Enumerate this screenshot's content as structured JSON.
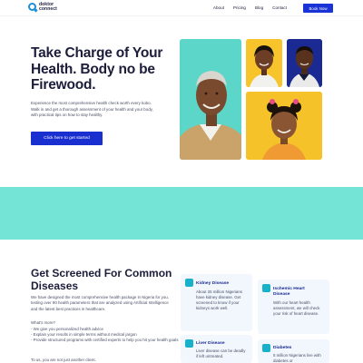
{
  "header": {
    "logo_line1": "doktor",
    "logo_line2": "connect",
    "nav": [
      "About",
      "Pricing",
      "Blog",
      "Contact"
    ],
    "book_label": "Book Now"
  },
  "hero": {
    "title": "Take Charge of Your Health. Body no be Firewood.",
    "description": "Experience the most comprehensive health check worth every kobo. Walk in and get a thorough assessment of your health and your body, with practical tips on how to stay healthy.",
    "cta_label": "Click here to get started"
  },
  "screening": {
    "title": "Get Screened For Common Diseases",
    "paragraph": "We have designed the most comprehensive health package in Nigeria for you, testing over 90 health parameters that are analyzed using Artificial Intelligence and the latest best practices in healthcare.",
    "whats_more": "What's more?",
    "list": [
      "- We give you personalized health advice",
      "- Explain your results in simple terms without medical jargon",
      "- Provide structured programs with certified experts to help you hit your health goals"
    ],
    "closing": "To us, you are not just another client."
  },
  "cards": [
    {
      "title": "Kidney Disease",
      "desc": "About 25 million Nigerians have kidney disease. Get screened to know if your kidneys work well."
    },
    {
      "title": "Ischemic Heart Disease",
      "desc": "With our heart health assessment, we will check your risk of heart disease."
    },
    {
      "title": "Liver Disease",
      "desc": "Liver disease can be deadly if left untreated."
    },
    {
      "title": "Diabetes",
      "desc": "5 million Nigerians live with diabetes or"
    }
  ],
  "colors": {
    "primary": "#1a33d6",
    "navy": "#1b1d3a",
    "teal": "#73e4d5",
    "yellow": "#f6c22a"
  }
}
